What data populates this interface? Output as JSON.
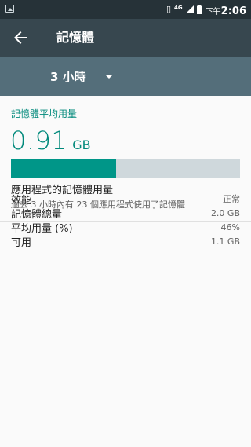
{
  "statusbar": {
    "network": "4G",
    "time_prefix": "下午",
    "time": "2:06"
  },
  "toolbar": {
    "title": "記憶體",
    "back_icon": "arrow-back-icon"
  },
  "spinner": {
    "selected": "3 小時"
  },
  "memory": {
    "section_title": "記憶體平均用量",
    "value": "0.91",
    "unit": "GB",
    "usage_fraction": 0.46,
    "rows": [
      {
        "label": "效能",
        "value": "正常"
      },
      {
        "label": "記憶體總量",
        "value": "2.0 GB"
      },
      {
        "label": "平均用量 (%)",
        "value": "46%"
      },
      {
        "label": "可用",
        "value": "1.1 GB"
      }
    ]
  },
  "apps_item": {
    "title": "應用程式的記憶體用量",
    "subtitle": "過去 3 小時內有 23 個應用程式使用了記憶體"
  },
  "colors": {
    "accent": "#009688",
    "toolbar": "#37474f",
    "statusbar": "#263238",
    "spinner_bar": "#546e7a"
  }
}
